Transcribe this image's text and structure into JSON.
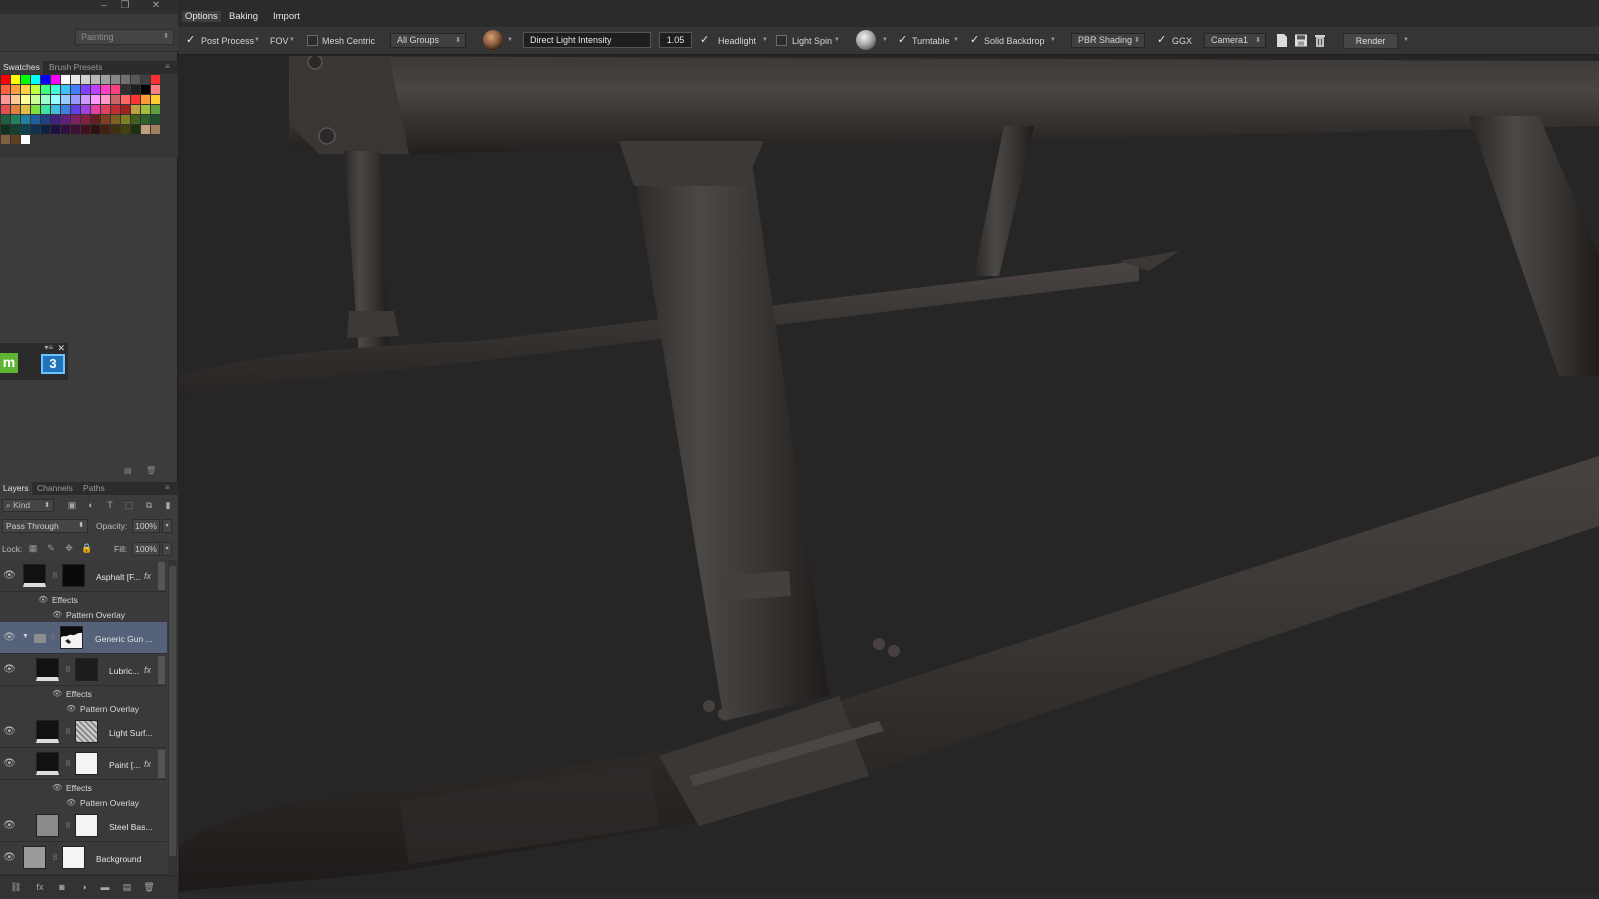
{
  "menu": {
    "options": "Options",
    "baking": "Baking",
    "import": "Import"
  },
  "workspace": {
    "label": "Painting"
  },
  "toolbar": {
    "post_process": "Post Process",
    "fov": "FOV",
    "mesh_centric": "Mesh Centric",
    "groups_select": "All Groups",
    "intensity_label": "Direct Light Intensity",
    "intensity_value": "1.05",
    "headlight": "Headlight",
    "light_spin": "Light Spin",
    "turntable": "Turntable",
    "solid_backdrop": "Solid Backdrop",
    "shading_select": "PBR Shading",
    "ggx": "GGX",
    "camera_select": "Camera1",
    "render": "Render",
    "post_process_checked": true,
    "mesh_centric_checked": false,
    "headlight_checked": true,
    "light_spin_checked": false,
    "turntable_checked": true,
    "solid_backdrop_checked": true,
    "ggx_checked": true
  },
  "swatches_panel": {
    "tab_swatches": "Swatches",
    "tab_brush_presets": "Brush Presets"
  },
  "plugin_panel": {
    "m_label": "m",
    "three_label": "3"
  },
  "layers_panel": {
    "tab_layers": "Layers",
    "tab_channels": "Channels",
    "tab_paths": "Paths",
    "kind": "Kind",
    "blend_mode": "Pass Through",
    "opacity_label": "Opacity:",
    "opacity_value": "100%",
    "lock_label": "Lock:",
    "fill_label": "Fill:",
    "fill_value": "100%",
    "layers": [
      {
        "name": "Asphalt [F...",
        "fx": "fx",
        "effects": "Effects",
        "effect_item": "Pattern Overlay"
      },
      {
        "name": "Generic Gun ...",
        "group": true
      },
      {
        "name": "Lubric...",
        "fx": "fx",
        "effects": "Effects",
        "effect_item": "Pattern Overlay"
      },
      {
        "name": "Light Surf..."
      },
      {
        "name": "Paint [...",
        "fx": "fx",
        "effects": "Effects",
        "effect_item": "Pattern Overlay"
      },
      {
        "name": "Steel Bas..."
      },
      {
        "name": "Background"
      }
    ]
  }
}
